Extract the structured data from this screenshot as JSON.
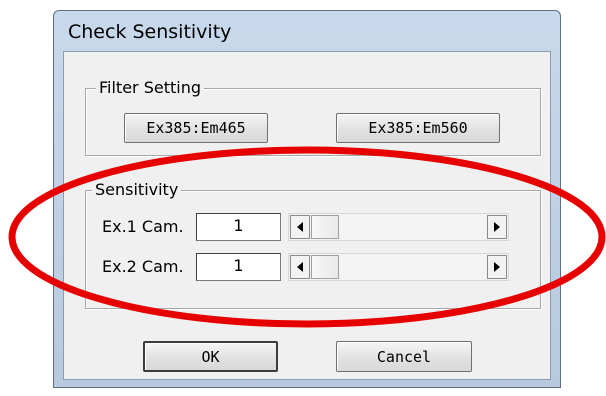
{
  "window": {
    "title": "Check Sensitivity"
  },
  "filter_setting": {
    "legend": "Filter Setting",
    "buttons": [
      "Ex385:Em465",
      "Ex385:Em560"
    ]
  },
  "sensitivity": {
    "legend": "Sensitivity",
    "rows": [
      {
        "label": "Ex.1 Cam.",
        "value": "1"
      },
      {
        "label": "Ex.2 Cam.",
        "value": "1"
      }
    ]
  },
  "actions": {
    "ok_label": "OK",
    "cancel_label": "Cancel"
  },
  "annotation": {
    "color": "#e60000"
  },
  "icons": {
    "scroll_left": "arrow-left-icon",
    "scroll_right": "arrow-right-icon"
  }
}
